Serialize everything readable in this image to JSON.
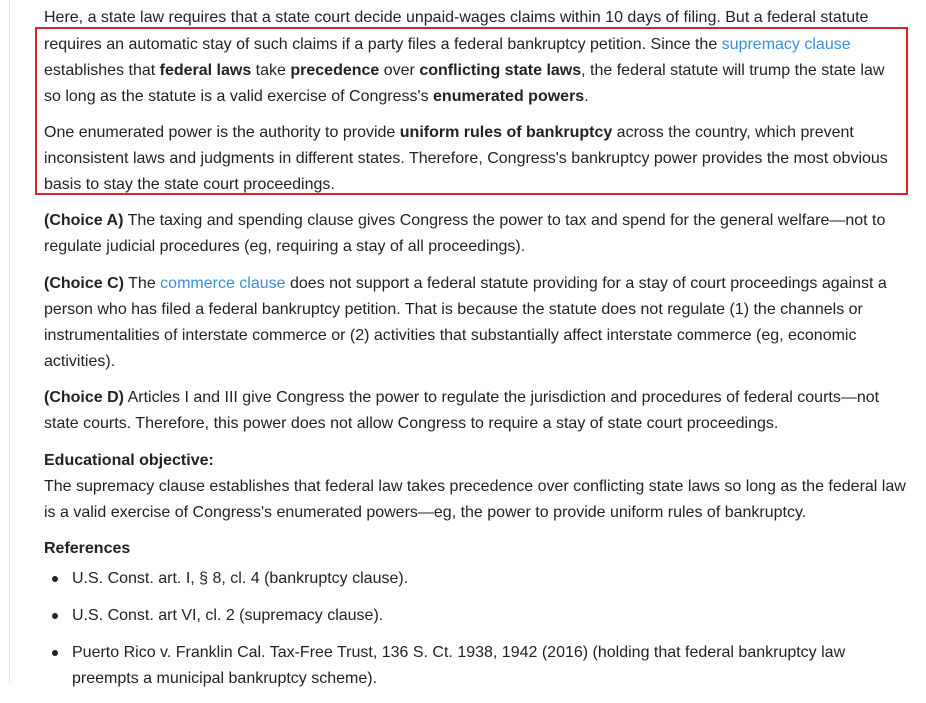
{
  "intro": "Here, a state law requires that a state court decide unpaid-wages claims within 10 days of filing.  But a federal statute",
  "highlight": {
    "p1": {
      "t1": "requires an automatic stay of such claims if a party files a federal bankruptcy petition.  Since the ",
      "link": "supremacy clause",
      "t2": " establishes that ",
      "b1": "federal laws",
      "t3": " take ",
      "b2": "precedence",
      "t4": " over ",
      "b3": "conflicting state laws",
      "t5": ", the federal statute will trump the state law so long as the statute is a valid exercise of Congress's ",
      "b4": "enumerated powers",
      "t6": "."
    },
    "p2": {
      "t1": "One enumerated power is the authority to provide ",
      "b1": "uniform rules of bankruptcy",
      "t2": " across the country, which prevent inconsistent laws and judgments in different states.  Therefore, Congress's bankruptcy power provides the most obvious basis to stay the state court proceedings."
    }
  },
  "choices": {
    "a": {
      "label": "(Choice A)",
      "text": "  The taxing and spending clause gives Congress the power to tax and spend for the general welfare—not to regulate judicial procedures (eg, requiring a stay of all proceedings)."
    },
    "c": {
      "label": "(Choice C)",
      "t1": "  The ",
      "link": "commerce clause",
      "t2": " does not support a federal statute providing for a stay of court proceedings against a person who has filed a federal bankruptcy petition.  That is because the statute does not regulate (1) the channels or instrumentalities of interstate commerce or (2) activities that substantially affect interstate commerce (eg, economic activities)."
    },
    "d": {
      "label": "(Choice D)",
      "text": "  Articles I and III give Congress the power to regulate the jurisdiction and procedures of federal courts—not state courts.  Therefore, this power does not allow Congress to require a stay of state court proceedings."
    }
  },
  "objective": {
    "heading": "Educational objective:",
    "text": "The supremacy clause establishes that federal law takes precedence over conflicting state laws so long as the federal law is a valid exercise of Congress's enumerated powers—eg, the power to provide uniform rules of bankruptcy."
  },
  "references": {
    "heading": "References",
    "items": [
      "U.S. Const. art. I, § 8, cl. 4 (bankruptcy clause).",
      "U.S. Const. art VI, cl. 2 (supremacy clause).",
      "Puerto Rico v. Franklin Cal. Tax-Free Trust, 136 S. Ct. 1938, 1942 (2016) (holding that federal bankruptcy law preempts a municipal bankruptcy scheme)."
    ]
  },
  "colors": {
    "highlight_border": "#d0282b",
    "link": "#3b8ed8",
    "text": "#222222"
  }
}
